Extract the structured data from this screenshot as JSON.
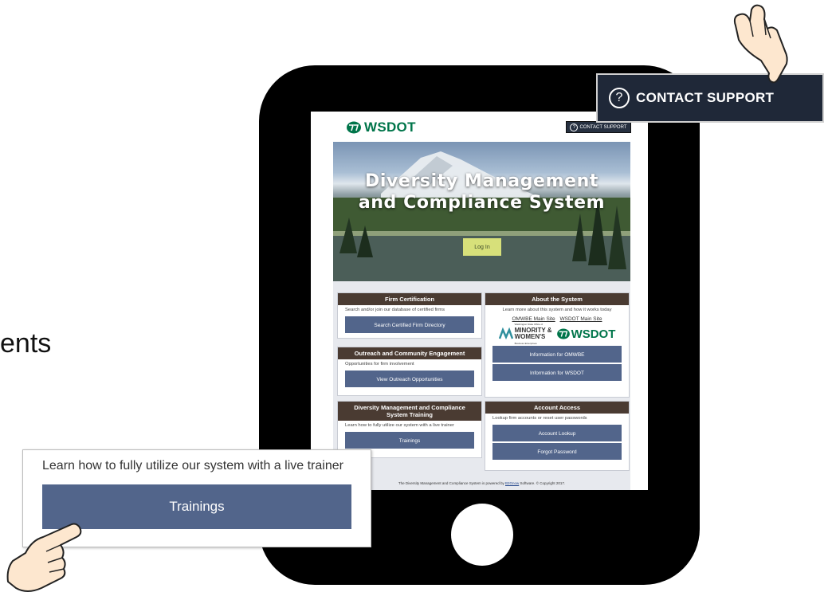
{
  "slide": {
    "partial_text": "ents"
  },
  "header": {
    "logo_text": "WSDOT",
    "contact_support_label": "CONTACT SUPPORT"
  },
  "hero": {
    "title_line1": "Diversity Management",
    "title_line2": "and Compliance System",
    "login_label": "Log In"
  },
  "firm_certification": {
    "title": "Firm Certification",
    "description": "Search and/or join our database of certified firms",
    "button_label": "Search Certified Firm Directory"
  },
  "outreach": {
    "title": "Outreach and Community Engagement",
    "description": "Opportunities for firm involvement",
    "button_label": "View Outreach Opportunities"
  },
  "training": {
    "title_line1": "Diversity Management and Compliance",
    "title_line2": "System Training",
    "description": "Learn how to fully utilize our system with a live trainer",
    "button_label": "Trainings"
  },
  "about": {
    "title": "About the System",
    "description": "Learn more about this system and how it works today",
    "link_omwbe": "OMWBE Main Site",
    "link_wsdot": "WSDOT Main Site",
    "omwbe_logo_small": "Washington State Office of",
    "omwbe_logo_line1": "MINORITY &",
    "omwbe_logo_line2": "WOMEN'S",
    "omwbe_logo_small2": "Business Enterprises",
    "wsdot_logo_text": "WSDOT",
    "button_omwbe": "Information for OMWBE",
    "button_wsdot": "Information for WSDOT"
  },
  "account": {
    "title": "Account Access",
    "description": "Lookup firm accounts or reset user passwords",
    "button_lookup": "Account Lookup",
    "button_forgot": "Forgot Password"
  },
  "footer": {
    "text_before": "The Diversity Management and Compliance System is powered by ",
    "link": "B2Gnow",
    "text_after": " Software. © Copyright 2017."
  },
  "zoom_callout": {
    "contact_support_label": "CONTACT SUPPORT",
    "training_description": "Learn how to fully utilize our system with a live trainer",
    "training_button_label": "Trainings"
  },
  "colors": {
    "tablet": "#000000",
    "wsdot_green": "#00754a",
    "card_header": "#4a3b32",
    "button_blue": "#52658b",
    "login_button": "#d7e07a",
    "contact_support_bg": "#1f2838"
  },
  "icons": [
    "wsdot-logo-icon",
    "question-icon",
    "omwbe-logo-icon",
    "pointing-hand-icon"
  ]
}
